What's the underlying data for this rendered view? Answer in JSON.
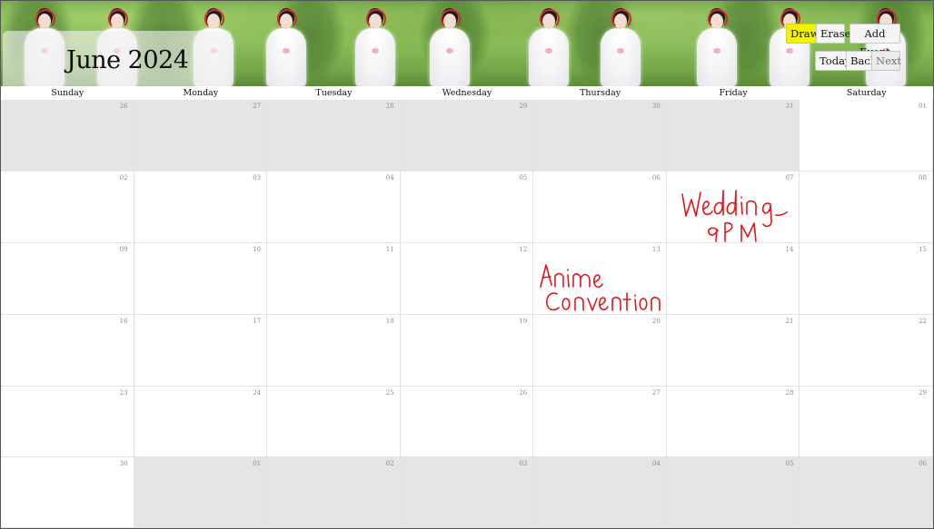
{
  "calendar": {
    "month_title": "June 2024"
  },
  "toolbar": {
    "draw": "Draw",
    "erase": "Erase",
    "add_event": "Add Event",
    "today": "Today",
    "back": "Back",
    "next": "Next"
  },
  "weekdays": [
    "Sunday",
    "Monday",
    "Tuesday",
    "Wednesday",
    "Thursday",
    "Friday",
    "Saturday"
  ],
  "weeks": [
    [
      {
        "d": "26",
        "other": true
      },
      {
        "d": "27",
        "other": true
      },
      {
        "d": "28",
        "other": true
      },
      {
        "d": "29",
        "other": true
      },
      {
        "d": "30",
        "other": true
      },
      {
        "d": "31",
        "other": true
      },
      {
        "d": "01",
        "other": false
      }
    ],
    [
      {
        "d": "02",
        "other": false
      },
      {
        "d": "03",
        "other": false
      },
      {
        "d": "04",
        "other": false
      },
      {
        "d": "05",
        "other": false
      },
      {
        "d": "06",
        "other": false
      },
      {
        "d": "07",
        "other": false
      },
      {
        "d": "08",
        "other": false
      }
    ],
    [
      {
        "d": "09",
        "other": false
      },
      {
        "d": "10",
        "other": false
      },
      {
        "d": "11",
        "other": false
      },
      {
        "d": "12",
        "other": false
      },
      {
        "d": "13",
        "other": false
      },
      {
        "d": "14",
        "other": false
      },
      {
        "d": "15",
        "other": false
      }
    ],
    [
      {
        "d": "16",
        "other": false
      },
      {
        "d": "17",
        "other": false
      },
      {
        "d": "18",
        "other": false
      },
      {
        "d": "19",
        "other": false
      },
      {
        "d": "20",
        "other": false
      },
      {
        "d": "21",
        "other": false
      },
      {
        "d": "22",
        "other": false
      }
    ],
    [
      {
        "d": "23",
        "other": false
      },
      {
        "d": "24",
        "other": false
      },
      {
        "d": "25",
        "other": false
      },
      {
        "d": "26",
        "other": false
      },
      {
        "d": "27",
        "other": false
      },
      {
        "d": "28",
        "other": false
      },
      {
        "d": "29",
        "other": false
      }
    ],
    [
      {
        "d": "30",
        "other": false
      },
      {
        "d": "01",
        "other": true
      },
      {
        "d": "02",
        "other": true
      },
      {
        "d": "03",
        "other": true
      },
      {
        "d": "04",
        "other": true
      },
      {
        "d": "05",
        "other": true
      },
      {
        "d": "06",
        "other": true
      }
    ]
  ],
  "handwritten_notes": [
    {
      "text": "Wedding 9PM",
      "cell": "June 07"
    },
    {
      "text": "Anime Convention",
      "cell": "June 13"
    }
  ],
  "colors": {
    "draw_active": "#f3f300",
    "ink": "#e0161b",
    "outside_month": "#e5e5e5"
  }
}
